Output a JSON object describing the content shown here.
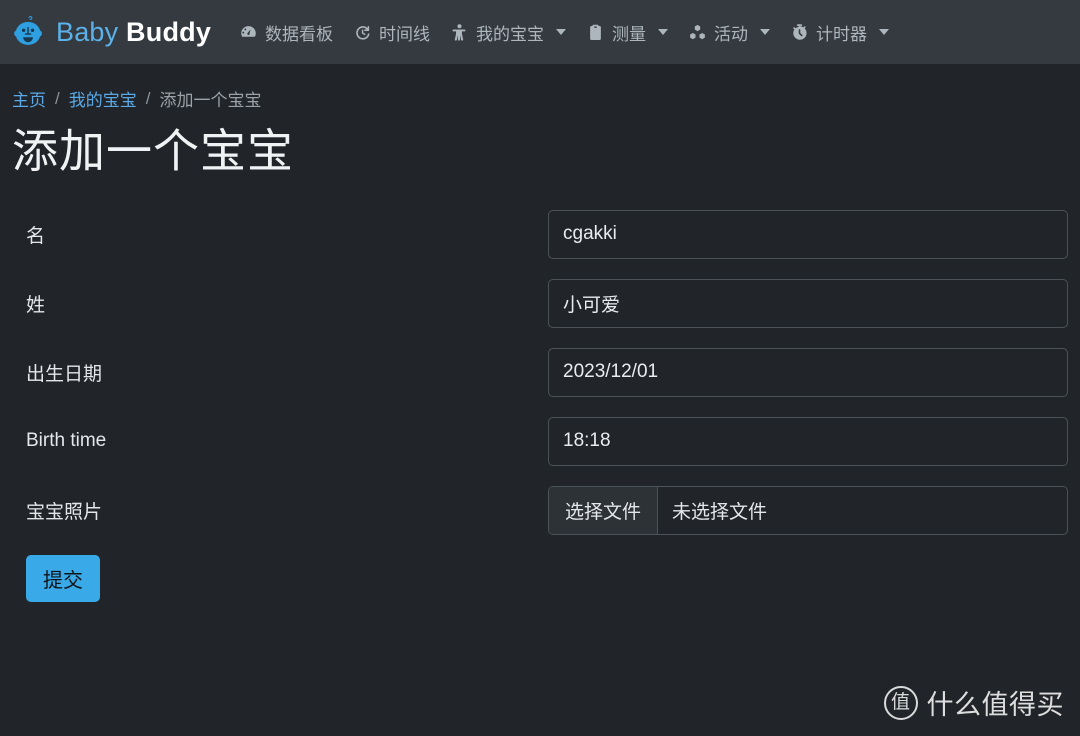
{
  "navbar": {
    "brand": {
      "icon": "baby-face-icon",
      "text_light": "Baby",
      "text_bold": "Buddy"
    },
    "items": [
      {
        "label": "数据看板",
        "icon": "gauge-icon",
        "has_caret": false
      },
      {
        "label": "时间线",
        "icon": "history-icon",
        "has_caret": false
      },
      {
        "label": "我的宝宝",
        "icon": "child-icon",
        "has_caret": true
      },
      {
        "label": "测量",
        "icon": "clipboard-icon",
        "has_caret": true
      },
      {
        "label": "活动",
        "icon": "cubes-icon",
        "has_caret": true
      },
      {
        "label": "计时器",
        "icon": "stopwatch-icon",
        "has_caret": true
      }
    ]
  },
  "breadcrumb": {
    "items": [
      {
        "label": "主页",
        "is_link": true
      },
      {
        "label": "我的宝宝",
        "is_link": true
      },
      {
        "label": "添加一个宝宝",
        "is_link": false
      }
    ],
    "separator": "/"
  },
  "page": {
    "title": "添加一个宝宝"
  },
  "form": {
    "fields": [
      {
        "label": "名",
        "value": "cgakki",
        "placeholder": "",
        "type": "text"
      },
      {
        "label": "姓",
        "value": "小可爱",
        "placeholder": "",
        "type": "text"
      },
      {
        "label": "出生日期",
        "value": "2023/12/01",
        "placeholder": "",
        "type": "text"
      },
      {
        "label": "Birth time",
        "value": "18:18",
        "placeholder": "",
        "type": "text"
      },
      {
        "label": "宝宝照片",
        "type": "file",
        "button_label": "选择文件",
        "file_status": "未选择文件"
      }
    ],
    "submit_label": "提交"
  },
  "watermark": {
    "badge": "值",
    "text": "什么值得买"
  },
  "colors": {
    "navbar_bg": "#343a40",
    "body_bg": "#212529",
    "accent": "#39a9e8",
    "link": "#5aa9e6",
    "muted": "#9aa1a8",
    "input_border": "#4b5258"
  }
}
